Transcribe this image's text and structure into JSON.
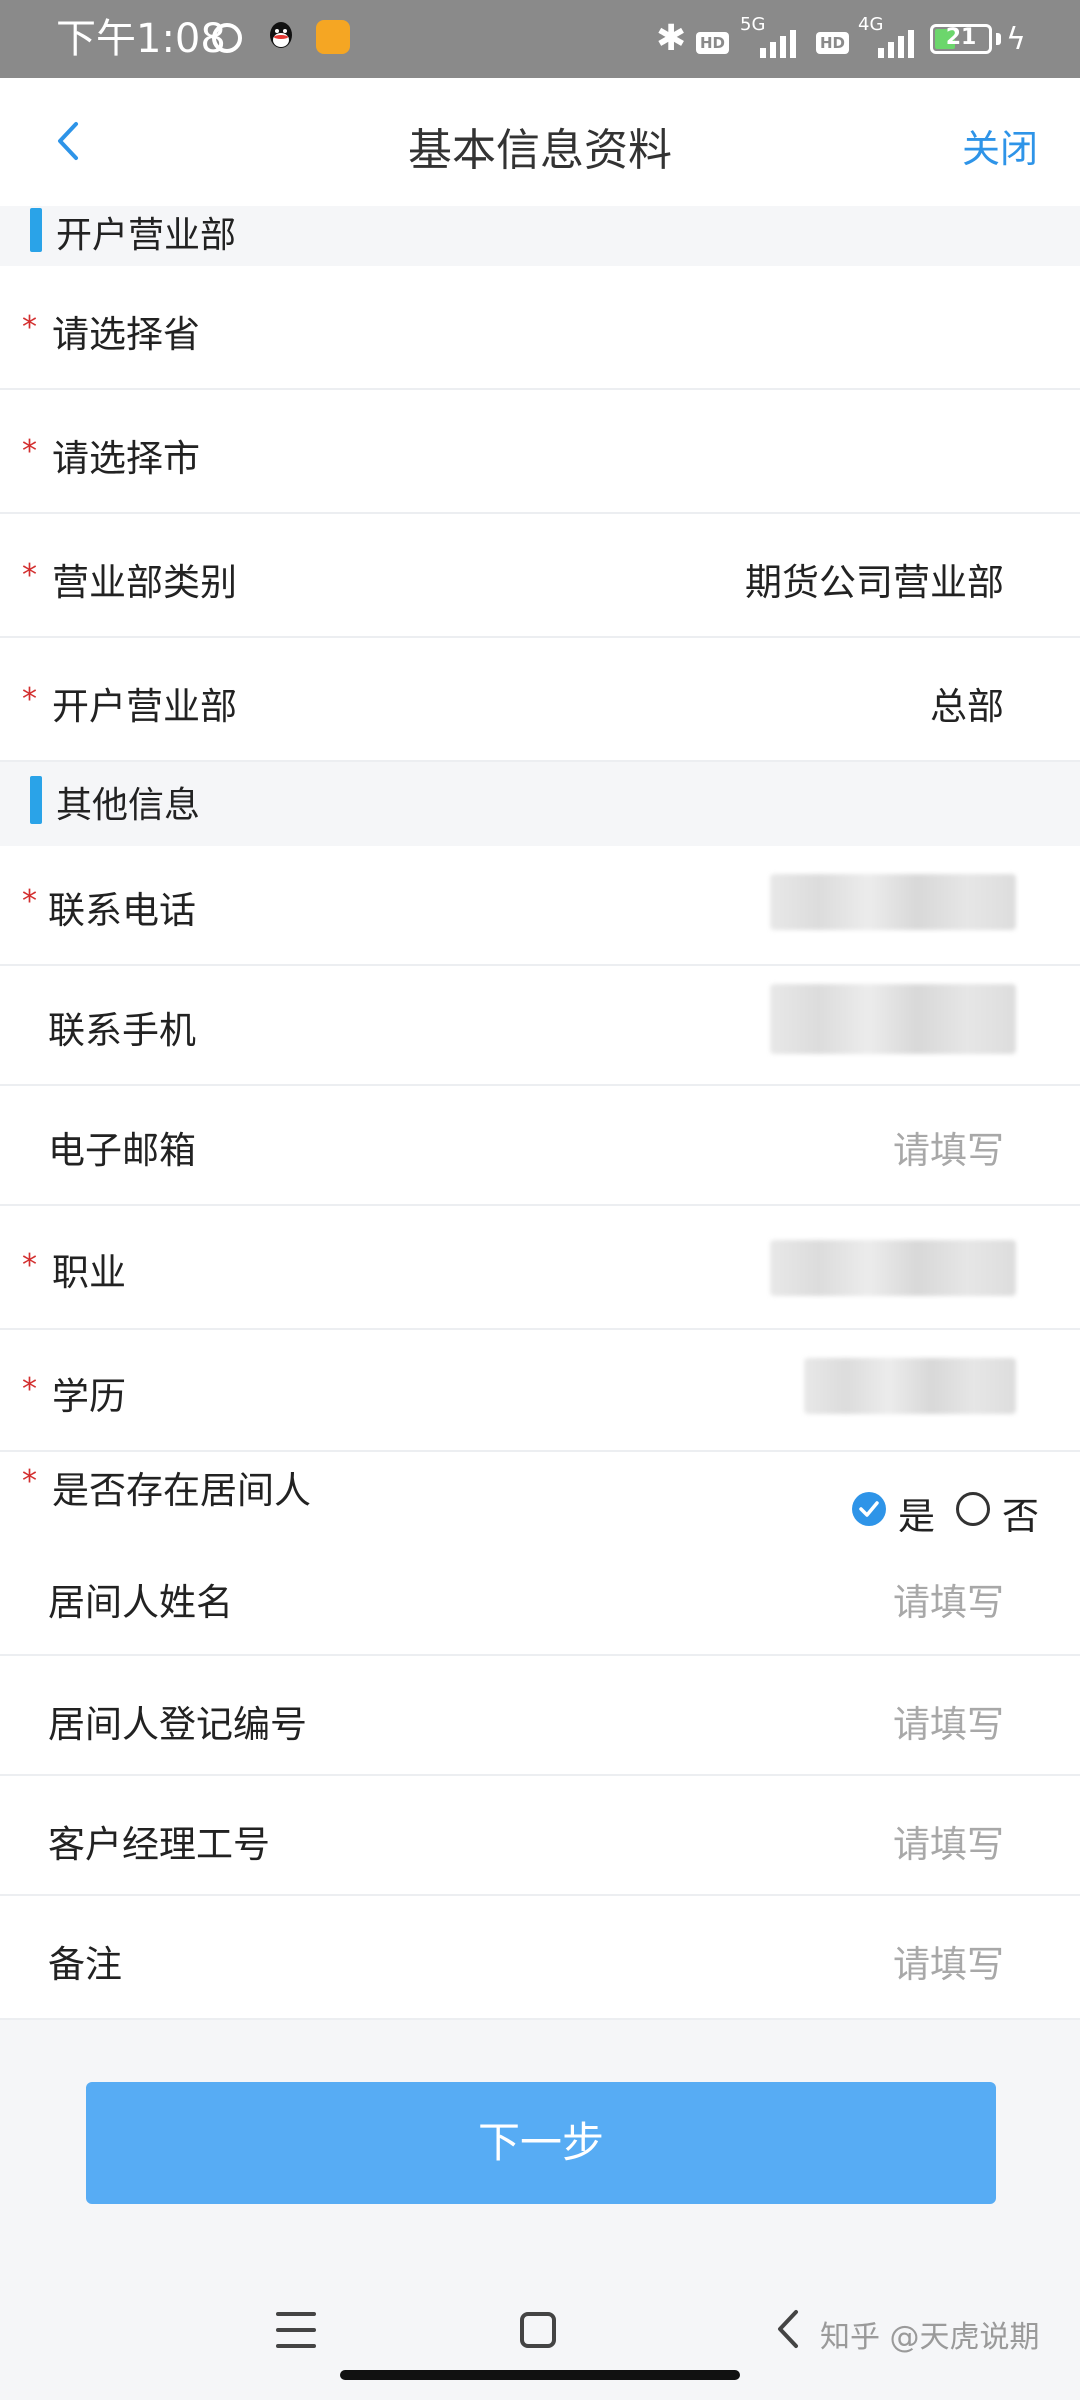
{
  "status_bar": {
    "time": "下午1:08",
    "network1": "5G",
    "network2": "4G",
    "hd": "HD",
    "battery": "21",
    "icons": [
      "alarm-icon",
      "qq-icon",
      "message-app-icon",
      "bluetooth-icon",
      "signal-icon",
      "battery-icon",
      "charging-icon"
    ]
  },
  "header": {
    "title": "基本信息资料",
    "close": "关闭"
  },
  "sections": {
    "account_dept": "开户营业部",
    "other_info": "其他信息"
  },
  "fields": {
    "province": {
      "label": "请选择省",
      "required": true,
      "value": ""
    },
    "city": {
      "label": "请选择市",
      "required": true,
      "value": ""
    },
    "dept_type": {
      "label": "营业部类别",
      "required": true,
      "value": "期货公司营业部"
    },
    "dept": {
      "label": "开户营业部",
      "required": true,
      "value": "总部"
    },
    "phone": {
      "label": "联系电话",
      "required": true
    },
    "mobile": {
      "label": "联系手机",
      "required": false
    },
    "email": {
      "label": "电子邮箱",
      "required": false,
      "placeholder": "请填写"
    },
    "job": {
      "label": "职业",
      "required": true
    },
    "education": {
      "label": "学历",
      "required": true
    },
    "intermediary": {
      "label": "是否存在居间人",
      "required": true,
      "options": [
        "是",
        "否"
      ],
      "selected": "是"
    },
    "intermediary_name": {
      "label": "居间人姓名",
      "placeholder": "请填写"
    },
    "intermediary_reg": {
      "label": "居间人登记编号",
      "placeholder": "请填写"
    },
    "manager_id": {
      "label": "客户经理工号",
      "placeholder": "请填写"
    },
    "remark": {
      "label": "备注",
      "placeholder": "请填写"
    }
  },
  "required_mark": "*",
  "next_button": "下一步",
  "watermark": "知乎 @天虎说期",
  "colors": {
    "accent": "#2e94e8",
    "button": "#57acf4",
    "required": "#d32f2f",
    "section_bar": "#2aa3e8"
  }
}
